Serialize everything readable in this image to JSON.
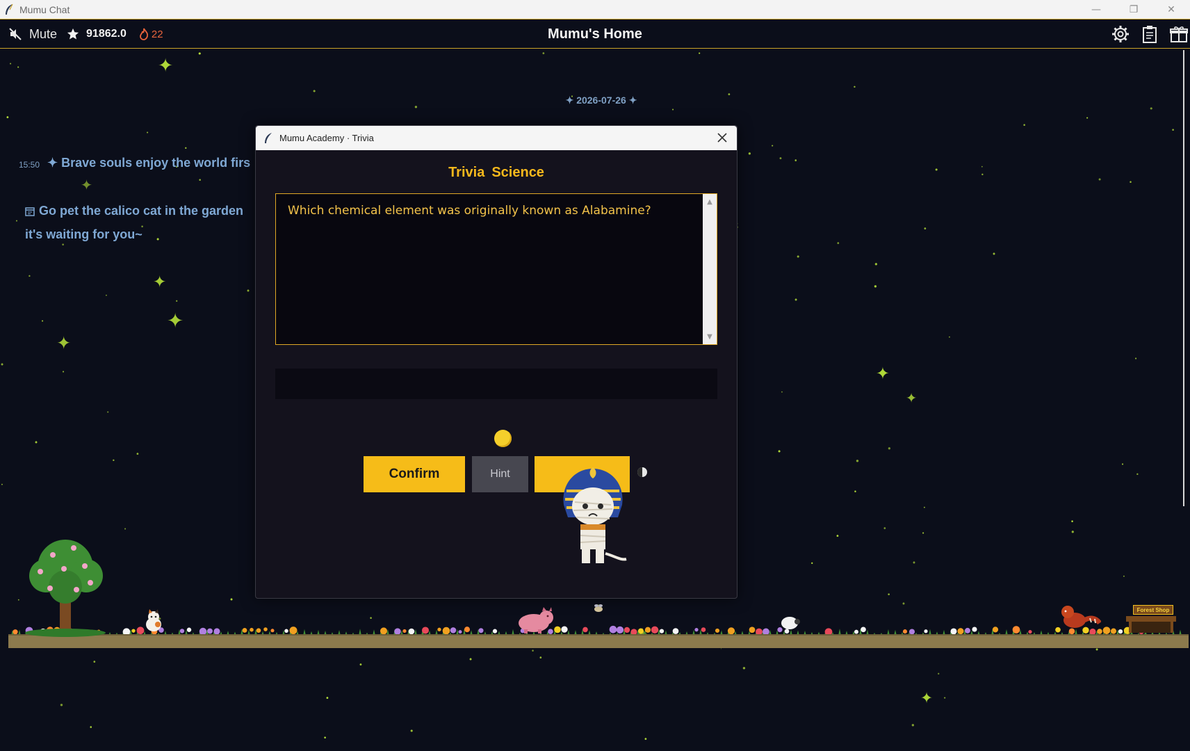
{
  "os_window": {
    "title": "Mumu Chat",
    "icon": "feather-icon",
    "controls": [
      "minimize-icon",
      "restore-icon",
      "close-icon"
    ]
  },
  "header": {
    "mute_label": "Mute",
    "score": "91862.0",
    "streak": "22",
    "title": "Mumu's Home",
    "right_icons": [
      "gear-icon",
      "clipboard-icon",
      "gift-icon"
    ]
  },
  "chat": {
    "date": "2026-07-26",
    "messages": [
      {
        "time": "15:50",
        "text": "Brave souls enjoy the world firs"
      },
      {
        "text_line1": "Go pet the calico cat in the garden",
        "text_line2": "it's waiting for you~"
      }
    ]
  },
  "dialog": {
    "title": "Mumu Academy · Trivia",
    "heading_category": "Trivia",
    "heading_topic": "Science",
    "question": "Which chemical element was originally known as Alabamine?",
    "answer_value": "",
    "buttons": {
      "confirm": "Confirm",
      "hint": "Hint",
      "third": ""
    }
  },
  "scene": {
    "shop_sign": "Forest Shop"
  },
  "colors": {
    "background": "#0b0e1a",
    "accent_gold": "#f6bc18",
    "chat_blue": "#7fa8d4",
    "star_green": "#b6e13a",
    "streak_orange": "#e8643c"
  }
}
